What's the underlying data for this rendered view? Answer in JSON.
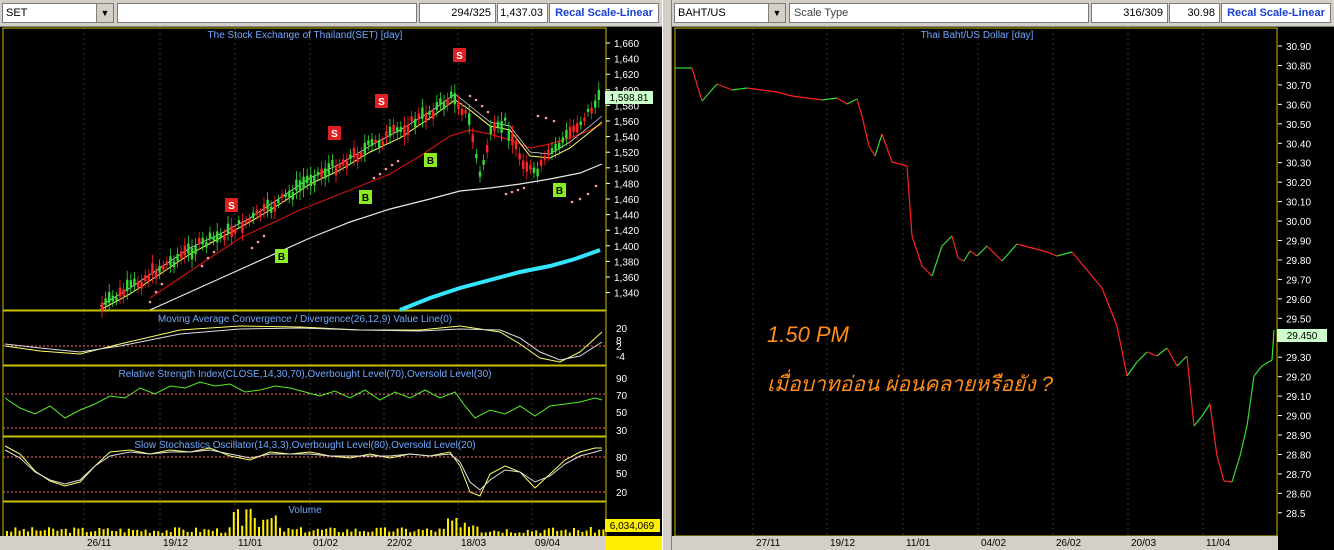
{
  "left_panel": {
    "symbol": "SET",
    "bar_count": "294/325",
    "last_value": "1,437.03",
    "recal_label": "Recal Scale-Linear",
    "title": "The Stock Exchange of Thailand(SET) [day]",
    "y_ticks": [
      "1,660",
      "1,640",
      "1,620",
      "1,600",
      "1,580",
      "1,560",
      "1,540",
      "1,520",
      "1,500",
      "1,480",
      "1,460",
      "1,440",
      "1,420",
      "1,400",
      "1,380",
      "1,360",
      "1,340"
    ],
    "price_tag": "1,598.81",
    "signals": [
      "S",
      "S",
      "S",
      "S",
      "S",
      "B",
      "B",
      "B",
      "B",
      "B"
    ],
    "macd": {
      "title": "Moving Average Convergence / Divergence(26,12,9) Value Line(0)",
      "ticks": [
        "20",
        "8",
        "2",
        "-4"
      ]
    },
    "rsi": {
      "title": "Relative Strength Index(CLOSE,14,30,70),Overbought Level(70),Oversold Level(30)",
      "ticks": [
        "90",
        "70",
        "50",
        "30"
      ]
    },
    "stoch": {
      "title": "Slow Stochastics Oscillator(14,3,3),Overbought Level(80),Oversold Level(20)",
      "ticks": [
        "80",
        "50",
        "20"
      ]
    },
    "volume": {
      "title": "Volume",
      "value": "6,034,069"
    },
    "x_labels": [
      "26/11",
      "19/12",
      "11/01",
      "01/02",
      "22/02",
      "18/03",
      "09/04"
    ]
  },
  "right_panel": {
    "symbol": "BAHT/US",
    "scale_type": "Scale Type",
    "bar_count": "316/309",
    "last_value": "30.98",
    "recal_label": "Recal Scale-Linear",
    "title": "Thai Baht/US Dollar [day]",
    "y_ticks": [
      "30.90",
      "30.80",
      "30.70",
      "30.60",
      "30.50",
      "30.40",
      "30.30",
      "30.20",
      "30.10",
      "30.00",
      "29.90",
      "29.80",
      "29.70",
      "29.60",
      "29.50",
      "29.40",
      "29.30",
      "29.20",
      "29.10",
      "29.00",
      "28.90",
      "28.80",
      "28.70",
      "28.60",
      "28.5"
    ],
    "price_tag": "29.450",
    "x_labels": [
      "27/11",
      "19/12",
      "11/01",
      "04/02",
      "26/02",
      "20/03",
      "11/04"
    ],
    "annotation_time": "1.50 PM",
    "annotation_text": "เมื่อบาทอ่อน ผ่อนคลายหรือยัง ?"
  },
  "colors": {
    "toolbar": "#d4d0c8",
    "recal_text": "#1a3fd6",
    "title_text": "#6fa8ff",
    "up": "#33dd33",
    "down": "#ff2222",
    "annotation": "#ff8c1a",
    "ma_cyan": "#33e5ff",
    "volume": "#ffee00",
    "price_tag_bg": "#ccffcc"
  }
}
